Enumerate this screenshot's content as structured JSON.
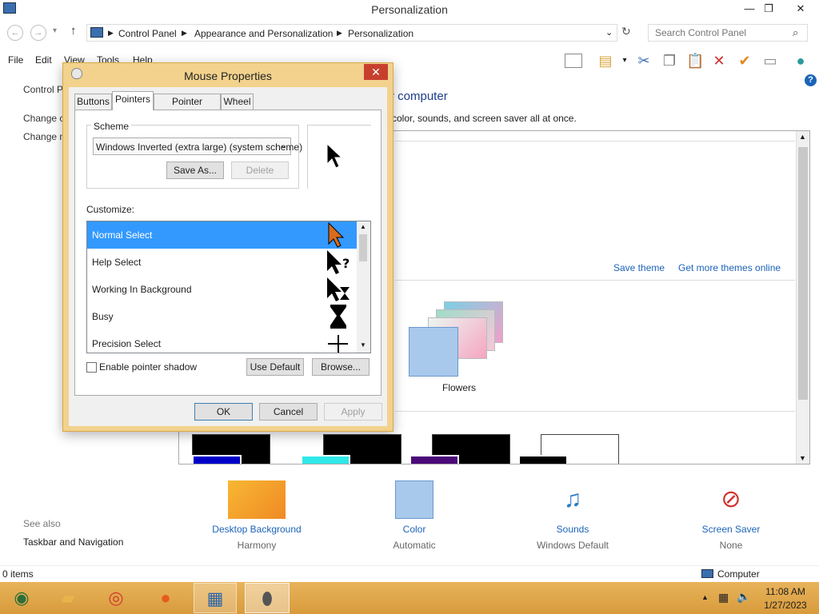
{
  "window": {
    "title": "Personalization",
    "minimize": "—",
    "restore": "❐",
    "close": "✕"
  },
  "address": {
    "crumbs": [
      "Control Panel",
      "Appearance and Personalization",
      "Personalization"
    ],
    "search_placeholder": "Search Control Panel"
  },
  "menu": [
    "File",
    "Edit",
    "View",
    "Tools",
    "Help"
  ],
  "content": {
    "left_links": [
      "Control P",
      "Change c",
      "Change m"
    ],
    "heading_partial": "r computer",
    "description_partial": "color, sounds, and screen saver all at once.",
    "save_theme": "Save theme",
    "get_more_themes": "Get more themes online",
    "theme_name": "Flowers"
  },
  "see_also": {
    "label": "See also",
    "links": [
      "Taskbar and Navigation"
    ]
  },
  "quick_items": [
    {
      "label": "Desktop Background",
      "value": "Harmony"
    },
    {
      "label": "Color",
      "value": "Automatic"
    },
    {
      "label": "Sounds",
      "value": "Windows Default"
    },
    {
      "label": "Screen Saver",
      "value": "None"
    }
  ],
  "status": {
    "items": "0 items",
    "location": "Computer"
  },
  "taskbar": {
    "time": "11:08 AM",
    "date": "1/27/2023"
  },
  "dialog": {
    "title": "Mouse Properties",
    "tabs": [
      "Buttons",
      "Pointers",
      "Pointer Options",
      "Wheel"
    ],
    "active_tab": "Pointers",
    "scheme_label": "Scheme",
    "scheme_value": "Windows Inverted (extra large) (system scheme)",
    "save_as": "Save As...",
    "delete": "Delete",
    "customize_label": "Customize:",
    "cursors": [
      {
        "label": "Normal Select",
        "selected": true
      },
      {
        "label": "Help Select",
        "selected": false
      },
      {
        "label": "Working In Background",
        "selected": false
      },
      {
        "label": "Busy",
        "selected": false
      },
      {
        "label": "Precision Select",
        "selected": false
      }
    ],
    "shadow_label": "Enable pointer shadow",
    "shadow_checked": false,
    "use_default": "Use Default",
    "browse": "Browse...",
    "ok": "OK",
    "cancel": "Cancel",
    "apply": "Apply"
  }
}
